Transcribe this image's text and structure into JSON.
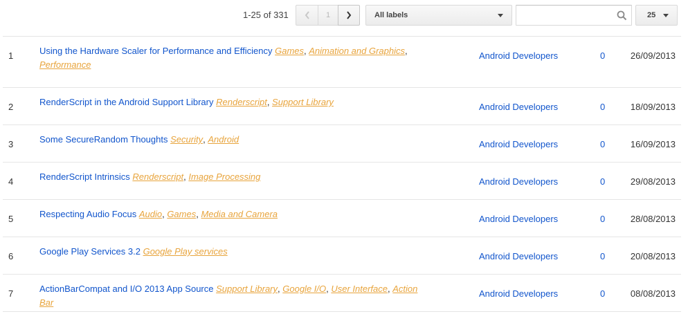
{
  "toolbar": {
    "range_text": "1-25 of 331",
    "current_page": "1",
    "labels_select": "All labels",
    "search_placeholder": "",
    "per_page": "25"
  },
  "posts": [
    {
      "num": "1",
      "title": "Using the Hardware Scaler for Performance and Efficiency",
      "labels": [
        "Games",
        "Animation and Graphics",
        "Performance"
      ],
      "author": "Android Developers",
      "comments": "0",
      "date": "26/09/2013"
    },
    {
      "num": "2",
      "title": "RenderScript in the Android Support Library",
      "labels": [
        "Renderscript",
        "Support Library"
      ],
      "author": "Android Developers",
      "comments": "0",
      "date": "18/09/2013"
    },
    {
      "num": "3",
      "title": "Some SecureRandom Thoughts",
      "labels": [
        "Security",
        "Android"
      ],
      "author": "Android Developers",
      "comments": "0",
      "date": "16/09/2013"
    },
    {
      "num": "4",
      "title": "RenderScript Intrinsics",
      "labels": [
        "Renderscript",
        "Image Processing"
      ],
      "author": "Android Developers",
      "comments": "0",
      "date": "29/08/2013"
    },
    {
      "num": "5",
      "title": "Respecting Audio Focus",
      "labels": [
        "Audio",
        "Games",
        "Media and Camera"
      ],
      "author": "Android Developers",
      "comments": "0",
      "date": "28/08/2013"
    },
    {
      "num": "6",
      "title": "Google Play Services 3.2",
      "labels": [
        "Google Play services"
      ],
      "author": "Android Developers",
      "comments": "0",
      "date": "20/08/2013"
    },
    {
      "num": "7",
      "title": "ActionBarCompat and I/O 2013 App Source",
      "labels": [
        "Support Library",
        "Google I/O",
        "User Interface",
        "Action Bar"
      ],
      "author": "Android Developers",
      "comments": "0",
      "date": "08/08/2013"
    }
  ],
  "icons": {
    "prev": "chevron-left-icon",
    "next": "chevron-right-icon",
    "search": "search-icon",
    "dropdown": "caret-down-icon"
  },
  "colors": {
    "link": "#1155cc",
    "label": "#e8a43c",
    "divider": "#e5e5e5"
  }
}
